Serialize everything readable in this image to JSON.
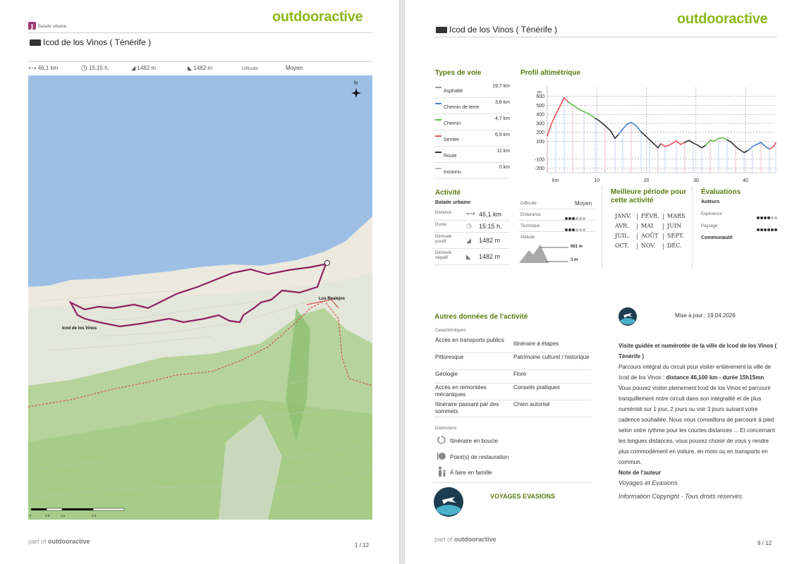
{
  "brand": "outdooractive",
  "page1": {
    "category": "Balade urbaine",
    "title": "Icod de los Vinos ( Ténérife )",
    "stats": {
      "distance": "46,1 km",
      "duration": "15:15 h.",
      "ascent": "1482 m",
      "descent": "1482 m",
      "difficulty_label": "Difficulté",
      "difficulty_value": "Moyen"
    },
    "map": {
      "north": "N",
      "towns": [
        "Icod de los Vinos",
        "Los Realejos"
      ],
      "scale": [
        "0",
        "0.8",
        "1.6",
        "2.4"
      ]
    },
    "footer": {
      "part_of": "part of",
      "brand": "outdooractive",
      "page": "1 / 12"
    }
  },
  "page2": {
    "title": "Icod de los Vinos ( Ténérife )",
    "types_de_voie": {
      "title": "Types de voie",
      "items": [
        {
          "label": "Asphalte",
          "value": "19,7 km",
          "color": "#999999"
        },
        {
          "label": "Chemin de terre",
          "value": "3,8 km",
          "color": "#4a7fd1"
        },
        {
          "label": "Chemin",
          "value": "4,7 km",
          "color": "#5fbf4a"
        },
        {
          "label": "Sentier",
          "value": "6,9 km",
          "color": "#e8505a"
        },
        {
          "label": "Route",
          "value": "11 km",
          "color": "#333333"
        },
        {
          "label": "Inconnu",
          "value": "0 km",
          "color": "#bbbbbb"
        }
      ]
    },
    "profile": {
      "title": "Profil altimétrique",
      "yunit": "m",
      "xunit": "km",
      "yticks": [
        "600",
        "500",
        "400",
        "300",
        "200",
        "100",
        "-100",
        "-200"
      ],
      "xticks": [
        "10",
        "20",
        "30",
        "40"
      ]
    },
    "activite": {
      "title": "Activité",
      "type": "Balade urbaine",
      "rows": [
        {
          "label": "Distance",
          "value": "46,1 km"
        },
        {
          "label": "Durée",
          "value": "15:15 h."
        },
        {
          "label": "Dénivelé positif",
          "value": "1482 m"
        },
        {
          "label": "Dénivelé négatif",
          "value": "1482 m"
        }
      ],
      "difficulty_label": "Difficulté",
      "difficulty_value": "Moyen",
      "endurance_label": "Endurance",
      "endurance_level": 3,
      "technique_label": "Technique",
      "technique_level": 3,
      "altitude_label": "Altitude",
      "alt_max": "681 m",
      "alt_min": "3 m"
    },
    "periode": {
      "title": "Meilleure période pour cette activité",
      "months": [
        "JANV.",
        "FÉVR.",
        "MARS",
        "AVR.",
        "MAI",
        "JUIN",
        "JUIL.",
        "AOÛT",
        "SEPT.",
        "OCT.",
        "NOV.",
        "DÉC."
      ]
    },
    "evaluations": {
      "title": "Évaluations",
      "auteurs": "Auteurs",
      "experience": "Expérience",
      "experience_level": 4,
      "paysage": "Paysage",
      "paysage_level": 6,
      "communaute": "Communauté"
    },
    "autres": {
      "title": "Autres données de l'activité",
      "caracteristiques": "Caractéristiques",
      "left": [
        "Accès en transports publics",
        "Pittoresque",
        "Géologie",
        "Accès en remontées mécaniques",
        "Itinéraire passant par des sommets"
      ],
      "right": [
        "Itinéraire à étapes",
        "Patrimoine culturel / historique",
        "Flore",
        "Conseils pratiques",
        "Chien autorisé"
      ],
      "distinctions": "Distinctions",
      "distinction_items": [
        "Itinéraire en boucle",
        "Point(s) de restauration",
        "À faire en famille"
      ],
      "author": "VOYAGES EVASIONS"
    },
    "description": {
      "update": "Mise à jour : 19.04.2026",
      "heading": "Visite guidée et numérotée de la ville de Icod de los Vinos ( Ténérife )",
      "p1": "Parcours intégral du circuit pour visiter entièrement la ville de Icod de los Vinos :",
      "p1_bold": "distance 46,100 km - durée 15h15mn",
      "p1_rest": "Vous pouvez visiter pleinement Icod de los Vinos et parcourir tranquillement notre circuit dans son intégralité et de plus numéroté sur 1 jour, 2 jours ou voir 3 jours suivant votre cadence souhaitée. Nous vous conseillons de parcourir à pied selon votre rythme pour les courtes distances ... Et concernant les longues distances, vous pouvez choisir de vous y rendre plus commodément en voiture, en moto ou en transports en commun.",
      "note_title": "Note de l'auteur",
      "note_author": "Voyages et Evasions",
      "copyright": "Information Copyright - Tous droits réservés."
    },
    "footer": {
      "part_of": "part of",
      "brand": "outdooractive",
      "page": "9 / 12"
    }
  }
}
